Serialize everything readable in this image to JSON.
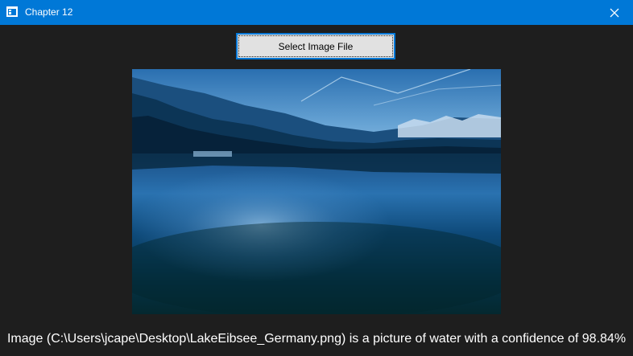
{
  "window": {
    "title": "Chapter 12",
    "icon": "app-window-icon",
    "close_icon": "close-icon"
  },
  "toolbar": {
    "select_label": "Select Image File"
  },
  "image": {
    "subject": "lake-with-mountains-icon"
  },
  "result": {
    "text": "Image (C:\\Users\\jcape\\Desktop\\LakeEibsee_Germany.png) is a picture of water with a confidence of 98.84%"
  },
  "colors": {
    "titlebar": "#0078d7",
    "background": "#1e1e1e",
    "button_face": "#e1e1e1",
    "button_border": "#0078d7",
    "text": "#ffffff"
  }
}
